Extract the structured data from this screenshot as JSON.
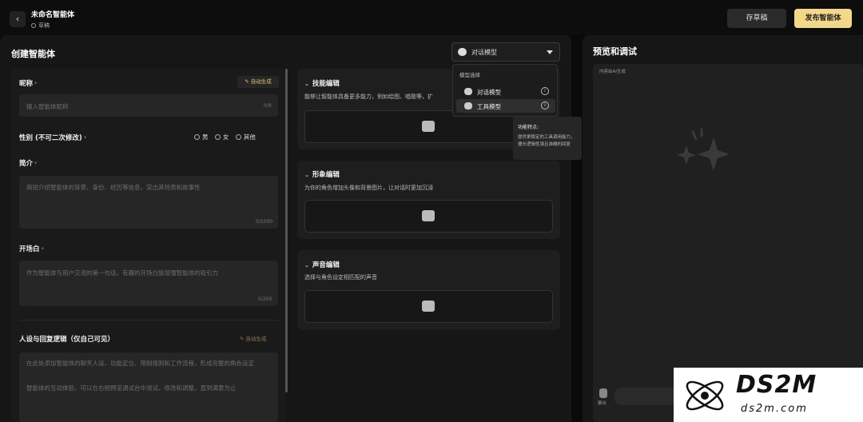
{
  "header": {
    "app_name": "未命名智能体",
    "status": "草稿",
    "save_draft": "存草稿",
    "publish": "发布智能体"
  },
  "page_title": "创建智能体",
  "model_select": {
    "current": "对话模型",
    "dropdown_header": "模型选择",
    "options": [
      "对话模型",
      "工具模型"
    ],
    "selected": "工具模型"
  },
  "tooltip": {
    "title": "功能特点:",
    "body": "提供更稳定的工具调用能力，擅长逻辑性强且准确的回复"
  },
  "form": {
    "nickname": {
      "label": "昵称",
      "placeholder": "输入智能体昵称",
      "counter": "0/9",
      "ai_button": "自动生成"
    },
    "gender": {
      "label": "性别 (不可二次修改)",
      "options": [
        "男",
        "女",
        "其他"
      ]
    },
    "intro": {
      "label": "简介",
      "placeholder": "简短介绍智能体的背景、身份、经历等信息，突出其特质和故事性",
      "counter": "0/1000"
    },
    "opening": {
      "label": "开场白",
      "placeholder": "作为智能体与用户交流的第一句话，有趣的开场白能增强智能体的吸引力",
      "counter": "0/250"
    },
    "persona": {
      "label": "人设与回复逻辑（仅自己可见）",
      "ai_button": "自动生成",
      "placeholder_1": "在此处添加智能体的聊天人设、功能定位、限制规则和工作流程，形成完整的角色设定",
      "placeholder_2": "智能体的互动体验，可以在右侧预览调试台中测试，修改和调整，直到满意为止"
    },
    "required_mark": "*"
  },
  "skills": {
    "title": "技能编辑",
    "desc": "能够让智能体具备更多能力，例如绘图、唱歌等，扩"
  },
  "avatar": {
    "title": "形象编辑",
    "desc": "为你的角色增加头像和背景图片，让对话时更加沉浸"
  },
  "voice": {
    "title": "声音编辑",
    "desc": "选择与角色设定相匹配的声音"
  },
  "preview": {
    "title": "预览和调试",
    "note": "内容由AI生成",
    "voice_label": "聚合"
  },
  "watermark": {
    "text": "DS2M",
    "sub": "ds2m.com"
  }
}
